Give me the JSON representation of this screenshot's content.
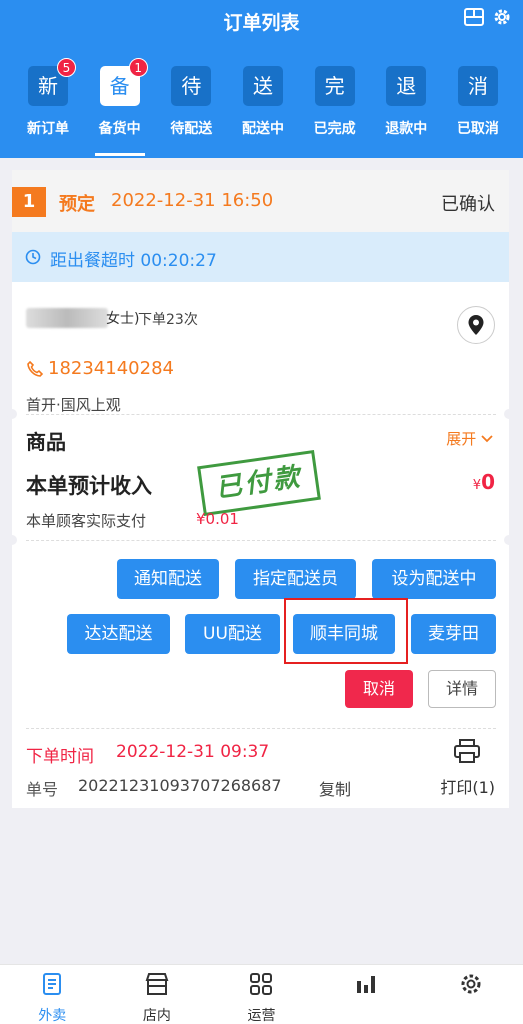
{
  "header": {
    "title": "订单列表"
  },
  "tabs": [
    {
      "icon": "新",
      "label": "新订单",
      "badge": "5"
    },
    {
      "icon": "备",
      "label": "备货中",
      "badge": "1"
    },
    {
      "icon": "待",
      "label": "待配送"
    },
    {
      "icon": "送",
      "label": "配送中"
    },
    {
      "icon": "完",
      "label": "已完成"
    },
    {
      "icon": "退",
      "label": "退款中"
    },
    {
      "icon": "消",
      "label": "已取消"
    }
  ],
  "order": {
    "index": "1",
    "type": "预定",
    "scheduled_time": "2022-12-31 16:50",
    "status": "已确认",
    "timeout_text": "距出餐超时 00:20:27",
    "customer_suffix": "女士)",
    "order_count": "下单23次",
    "phone": "18234140284",
    "address": "首开·国风上观",
    "goods_label": "商品",
    "expand_label": "展开",
    "income_label": "本单预计收入",
    "income_currency": "¥",
    "income_value": "0",
    "paid_label": "本单顾客实际支付",
    "paid_value": "¥0.01",
    "stamp_text": "已付款",
    "buttons": {
      "notify": "通知配送",
      "assign": "指定配送员",
      "set_delivering": "设为配送中",
      "dada": "达达配送",
      "uu": "UU配送",
      "sf": "顺丰同城",
      "maiyatian": "麦芽田",
      "cancel": "取消",
      "detail": "详情"
    },
    "order_time_label": "下单时间",
    "order_time": "2022-12-31 09:37",
    "order_no_label": "单号",
    "order_no": "20221231093707268687",
    "copy_label": "复制",
    "print_label": "打印(1)"
  },
  "bottom_nav": [
    {
      "label": "外卖",
      "icon": "takeout-icon"
    },
    {
      "label": "店内",
      "icon": "store-icon"
    },
    {
      "label": "运营",
      "icon": "grid-icon"
    },
    {
      "label": "",
      "icon": "stats-icon"
    },
    {
      "label": "",
      "icon": "settings-icon"
    }
  ],
  "colors": {
    "primary": "#2b8ef0",
    "orange": "#f47a1f",
    "red": "#f02444",
    "green": "#3f9a3f"
  }
}
